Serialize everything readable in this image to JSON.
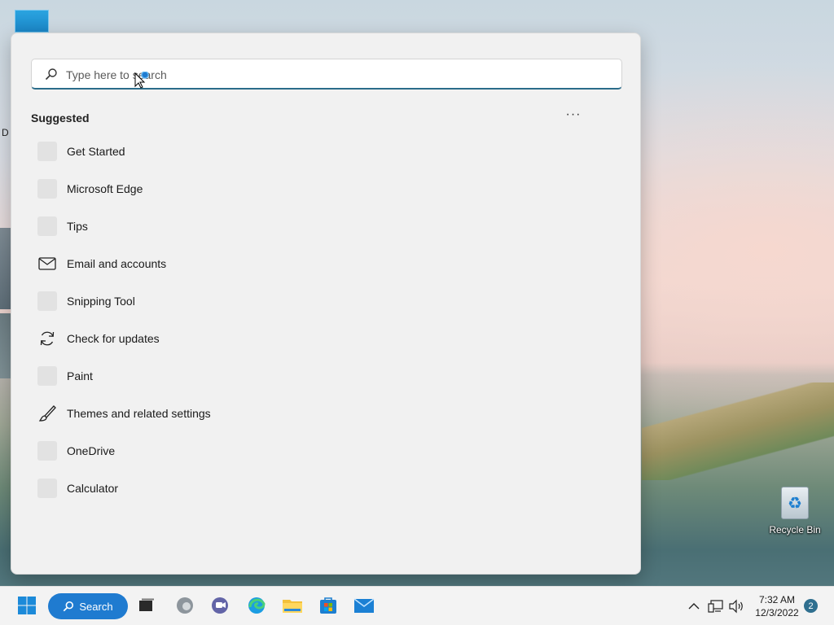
{
  "desktop": {
    "recycle_bin_label": "Recycle Bin",
    "partial_label": "D"
  },
  "start_menu": {
    "search": {
      "placeholder": "Type here to search",
      "value": ""
    },
    "suggested_heading": "Suggested",
    "more_options": "···",
    "items": [
      {
        "label": "Get Started",
        "icon": "placeholder-icon"
      },
      {
        "label": "Microsoft Edge",
        "icon": "placeholder-icon"
      },
      {
        "label": "Tips",
        "icon": "placeholder-icon"
      },
      {
        "label": "Email and accounts",
        "icon": "mail-icon"
      },
      {
        "label": "Snipping Tool",
        "icon": "placeholder-icon"
      },
      {
        "label": "Check for updates",
        "icon": "refresh-icon"
      },
      {
        "label": "Paint",
        "icon": "placeholder-icon"
      },
      {
        "label": "Themes and related settings",
        "icon": "brush-icon"
      },
      {
        "label": "OneDrive",
        "icon": "placeholder-icon"
      },
      {
        "label": "Calculator",
        "icon": "placeholder-icon"
      }
    ]
  },
  "taskbar": {
    "search_label": "Search",
    "pinned": [
      "windows-start-icon",
      "task-view-icon",
      "edge-beta-icon",
      "teams-chat-icon",
      "edge-icon",
      "file-explorer-icon",
      "microsoft-store-icon",
      "mail-icon"
    ],
    "clock_time": "7:32 AM",
    "clock_date": "12/3/2022",
    "notification_count": "2"
  },
  "colors": {
    "accent": "#1f7bd0",
    "panel_bg": "#f1f1f1",
    "taskbar_bg": "#f3f3f3"
  }
}
